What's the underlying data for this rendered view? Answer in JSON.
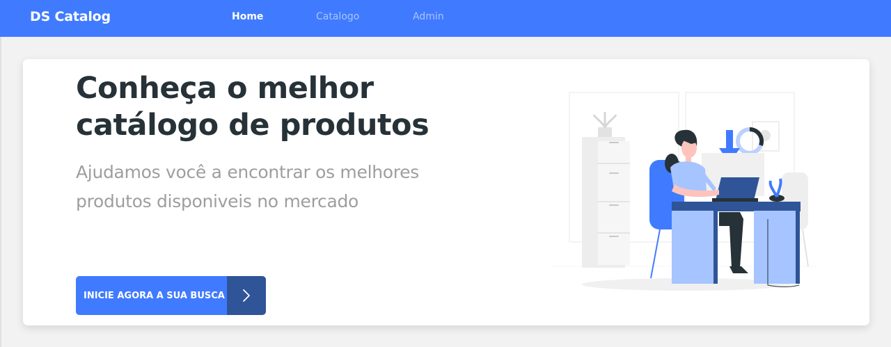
{
  "navbar": {
    "brand": "DS Catalog",
    "links": [
      {
        "label": "Home",
        "active": true
      },
      {
        "label": "Catalogo",
        "active": false
      },
      {
        "label": "Admin",
        "active": false
      }
    ]
  },
  "hero": {
    "title": "Conheça o melhor catálogo de produtos",
    "subtitle": "Ajudamos você a encontrar os melhores produtos disponiveis no mercado",
    "cta_label": "INICIE AGORA A SUA BUSCA",
    "cta_icon": "chevron-right-icon",
    "illustration": "woman-working-at-desk-illustration"
  },
  "colors": {
    "primary": "#407bff",
    "primary_dark": "#2f5598",
    "title": "#263238",
    "subtitle": "#9e9e9e",
    "background": "#f2f2f2"
  }
}
